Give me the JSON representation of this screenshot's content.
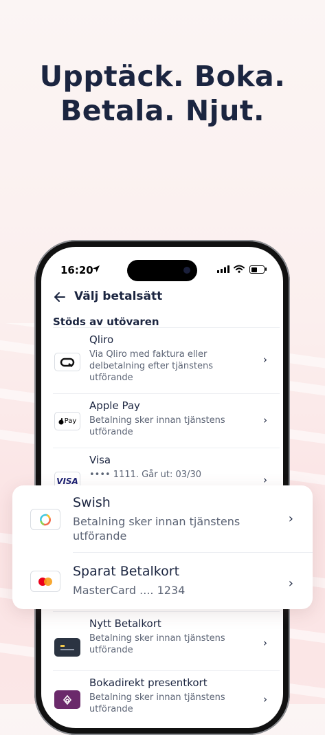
{
  "headline": {
    "line1": "Upptäck. Boka.",
    "line2": "Betala. Njut."
  },
  "status_bar": {
    "time": "16:20",
    "battery_level": 0.5
  },
  "nav": {
    "title": "Välj betalsätt"
  },
  "section_title": "Stöds av utövaren",
  "payment_methods": [
    {
      "title": "Qliro",
      "subtitle": "Via Qliro med faktura eller delbetalning efter tjänstens utförande",
      "icon": "qliro-icon"
    },
    {
      "title": "Apple Pay",
      "subtitle": "Betalning sker innan tjänstens utförande",
      "icon": "apple-pay-icon",
      "icon_text": "Pay"
    },
    {
      "title": "Visa",
      "subtitle": "•••• 1111. Går ut: 03/30",
      "icon": "visa-icon",
      "icon_text": "VISA"
    },
    {
      "title": "Nytt Betalkort",
      "subtitle": "Betalning sker innan tjänstens utförande",
      "icon": "card-icon"
    },
    {
      "title": "Bokadirekt presentkort",
      "subtitle": "Betalning sker innan tjänstens utförande",
      "icon": "gift-card-icon"
    }
  ],
  "featured": [
    {
      "title": "Swish",
      "subtitle": "Betalning sker innan tjänstens utförande",
      "icon": "swish-icon"
    },
    {
      "title": "Sparat Betalkort",
      "subtitle": "MasterCard .... 1234",
      "icon": "mastercard-icon"
    }
  ],
  "colors": {
    "navy": "#1b2540",
    "background": "#fbefee",
    "visa_blue": "#1a1f71",
    "mastercard_red": "#eb001b",
    "mastercard_orange": "#f79e1b",
    "gift_purple": "#6b2a6b"
  }
}
